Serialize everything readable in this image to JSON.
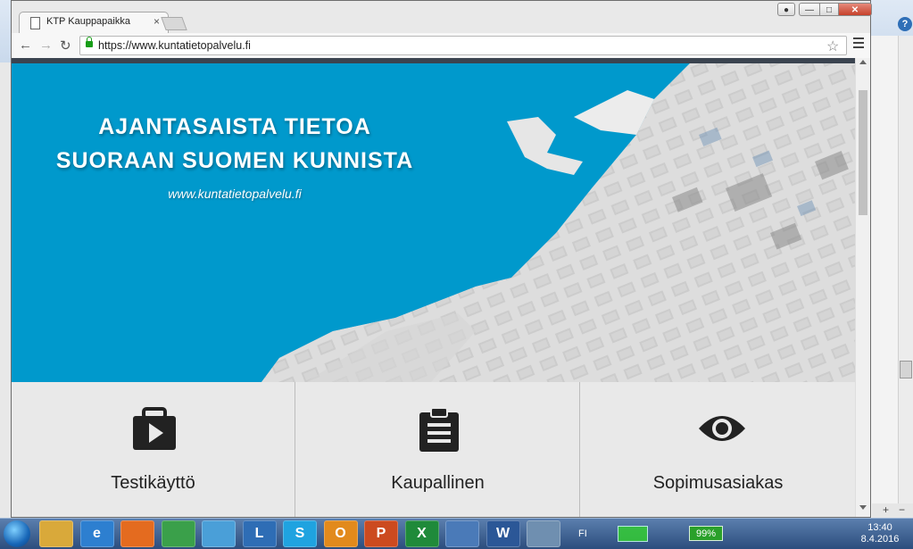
{
  "browser": {
    "tab_title": "KTP Kauppapaikka",
    "tab_close": "×",
    "url": "https://www.kuntatietopalvelu.fi",
    "window_controls": {
      "minimize": "—",
      "maximize": "□",
      "close": "✕"
    }
  },
  "hero": {
    "title_line1": "AJANTASAISTA TIETOA",
    "title_line2": "SUORAAN SUOMEN KUNNISTA",
    "site_url": "www.kuntatietopalvelu.fi",
    "accent_color": "#0099cc"
  },
  "cards": [
    {
      "label": "Testikäyttö",
      "icon": "briefcase-play-icon"
    },
    {
      "label": "Kaupallinen",
      "icon": "clipboard-icon"
    },
    {
      "label": "Sopimusasiakas",
      "icon": "eye-icon"
    }
  ],
  "taskbar": {
    "apps": [
      "File Explorer",
      "Internet Explorer",
      "Firefox",
      "Chrome",
      "Globe",
      "Lync",
      "Skype",
      "Outlook",
      "PowerPoint",
      "Excel",
      "Cloud",
      "Word",
      "Manager"
    ],
    "app_glyphs": [
      "",
      "e",
      "",
      "",
      "",
      "L",
      "S",
      "O",
      "P",
      "X",
      "",
      "W",
      ""
    ],
    "language": "FI",
    "battery": "99%",
    "time": "13:40",
    "date": "8.4.2016"
  },
  "background_app": {
    "help": "?",
    "zoom_plus": "+",
    "zoom_minus": "−"
  }
}
